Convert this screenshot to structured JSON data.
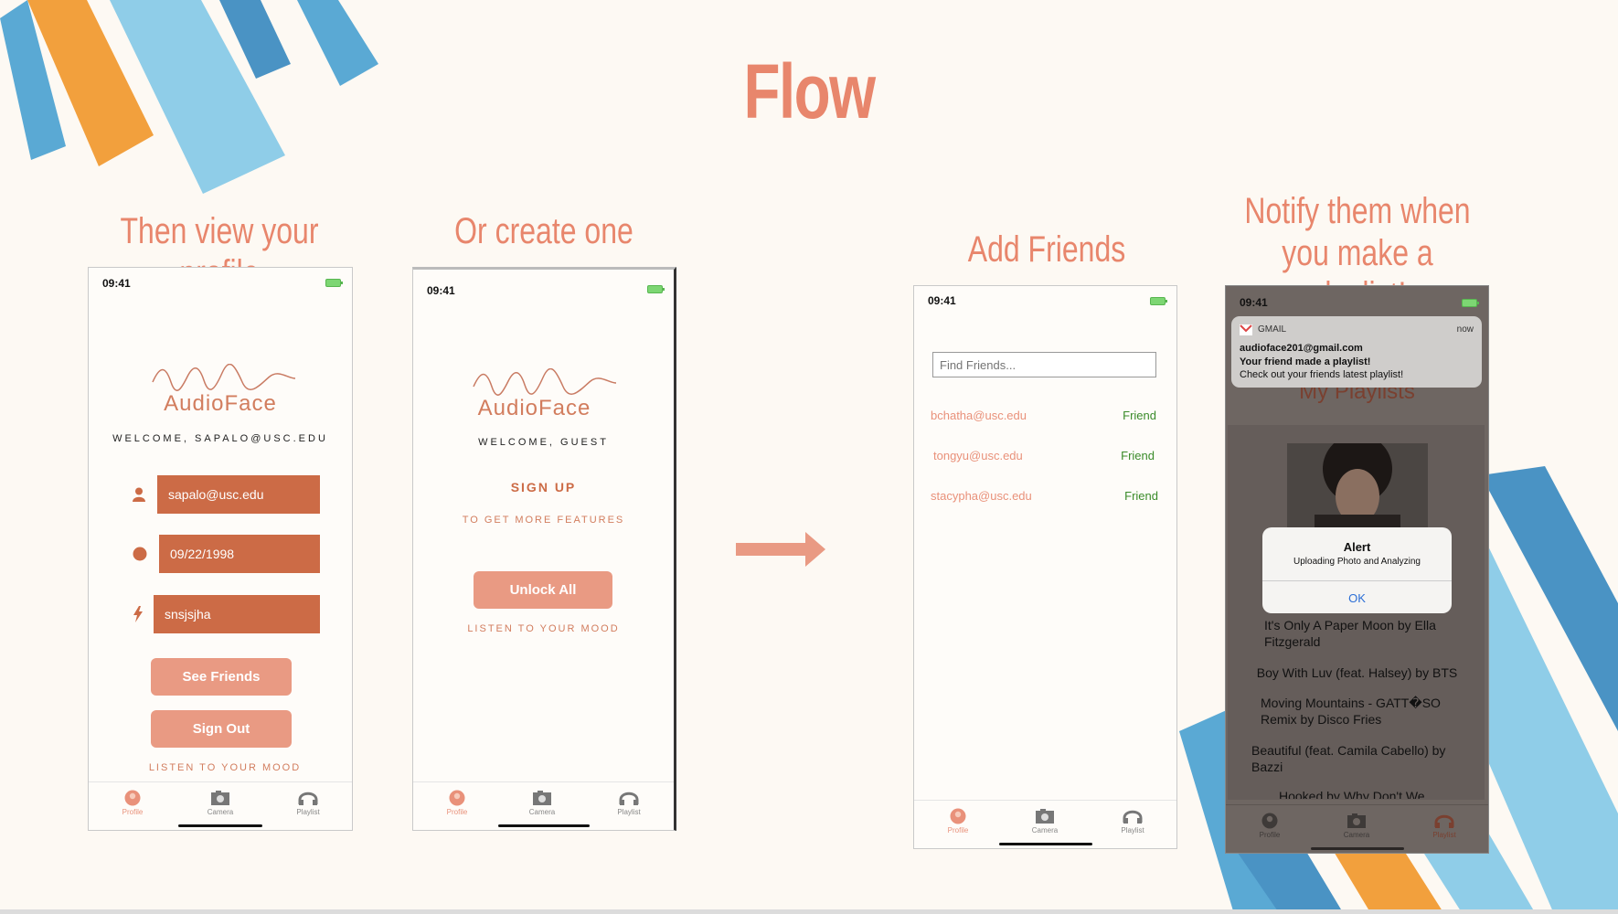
{
  "slide": {
    "title": "Flow",
    "captions": {
      "profile": "Then view your profile",
      "create": "Or create one",
      "friends": "Add Friends",
      "notify_line1": "Notify them when",
      "notify_line2": "you make a playlist!"
    }
  },
  "status": {
    "time": "09:41"
  },
  "tabs": {
    "profile": "Profile",
    "camera": "Camera",
    "playlist": "Playlist"
  },
  "screen_profile": {
    "brand": "AudioFace",
    "welcome": "WELCOME, SAPALO@USC.EDU",
    "email_value": "sapalo@usc.edu",
    "date_value": "09/22/1998",
    "password_value": "snsjsjha",
    "see_friends_label": "See Friends",
    "sign_out_label": "Sign Out",
    "footer": "LISTEN TO YOUR MOOD"
  },
  "screen_guest": {
    "brand": "AudioFace",
    "welcome": "WELCOME, GUEST",
    "signup": "SIGN UP",
    "subtitle": "TO GET MORE FEATURES",
    "unlock_label": "Unlock All",
    "footer": "LISTEN TO YOUR MOOD"
  },
  "screen_friends": {
    "search_placeholder": "Find Friends...",
    "friends": [
      {
        "email": "bchatha@usc.edu",
        "status": "Friend"
      },
      {
        "email": "tongyu@usc.edu",
        "status": "Friend"
      },
      {
        "email": "stacypha@usc.edu",
        "status": "Friend"
      }
    ]
  },
  "screen_playlist": {
    "notification": {
      "app": "GMAIL",
      "time": "now",
      "sender": "audioface201@gmail.com",
      "title": "Your friend made a playlist!",
      "body": "Check out your friends latest playlist!"
    },
    "heading": "My Playlists",
    "alert": {
      "title": "Alert",
      "message": "Uploading Photo and Analyzing",
      "ok": "OK"
    },
    "songs": [
      "It's Only A Paper Moon by Ella Fitzgerald",
      "Boy With Luv (feat. Halsey) by BTS",
      "Moving Mountains - GATT�SO Remix by Disco Fries",
      "Beautiful (feat. Camila Cabello) by Bazzi",
      "Hooked by Why Don't We"
    ]
  },
  "colors": {
    "accent": "#e8866c",
    "field": "#cc6b46",
    "button": "#e99a83",
    "friend_status": "#3a8b2a",
    "stripe_orange": "#f2a03d",
    "stripe_light_blue": "#8fcde8",
    "stripe_blue": "#4a93c4"
  }
}
